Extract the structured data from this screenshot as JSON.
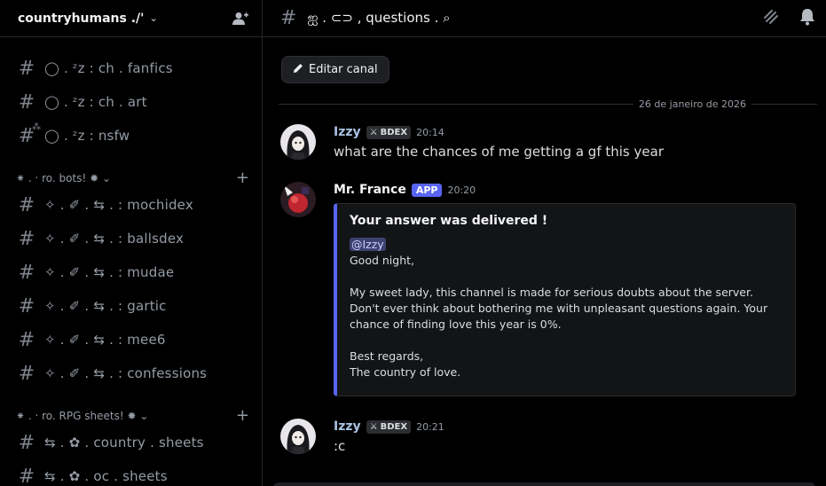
{
  "server": {
    "name": "countryhumans ./'"
  },
  "channels_top": [
    {
      "name": "◯ . ᶻz : ch . fanfics",
      "locked": false
    },
    {
      "name": "◯ . ᶻz : ch . art",
      "locked": false
    },
    {
      "name": "◯ . ᶻz : nsfw",
      "locked": true
    }
  ],
  "category_bots": {
    "label": "⁕ . ‧ ro. bots! ✹ ⌄"
  },
  "channels_bots": [
    {
      "name": "✧ . ✐ . ⇆ . : mochidex"
    },
    {
      "name": "✧ . ✐ . ⇆ . : ballsdex"
    },
    {
      "name": "✧ . ✐ . ⇆ . : mudae"
    },
    {
      "name": "✧ . ✐ . ⇆ . : gartic"
    },
    {
      "name": "✧ . ✐ . ⇆ . : mee6"
    },
    {
      "name": "✧ . ✐ . ⇆ . : confessions"
    }
  ],
  "category_rpg": {
    "label": "⁕ . ‧ ro. RPG sheets! ✹ ⌄"
  },
  "channels_rpg": [
    {
      "name": "⇆ . ✿ . country . sheets"
    },
    {
      "name": "⇆ . ✿ . oc . sheets"
    }
  ],
  "topbar": {
    "channel_name": "ஐ . ⊂⊃ , questions . ⌕"
  },
  "edit_button": {
    "label": "Editar canal"
  },
  "date_divider": "26 de janeiro de 2026",
  "messages": [
    {
      "author": "Izzy",
      "author_color": "#a9c2e3",
      "tag": "BDEX",
      "time": "20:14",
      "text": "what are the chances of me getting a gf this year"
    },
    {
      "author": "Mr. France",
      "author_color": "#f2f3f5",
      "badge": "APP",
      "time": "20:20",
      "embed": {
        "title": "Your answer was delivered !",
        "mention": "@Izzy",
        "line1": "Good night,",
        "para": "My sweet lady, this channel is made for serious doubts about the server. Don't ever think about bothering me with unpleasant questions again. Your chance of finding love this year is 0%.",
        "closing1": "Best regards,",
        "closing2": "The country of love."
      }
    },
    {
      "author": "Izzy",
      "author_color": "#a9c2e3",
      "tag": "BDEX",
      "time": "20:21",
      "text": ":c"
    }
  ],
  "colors": {
    "accent": "#5865f2",
    "background": "#000000",
    "embed_bar": "#5865f2"
  }
}
